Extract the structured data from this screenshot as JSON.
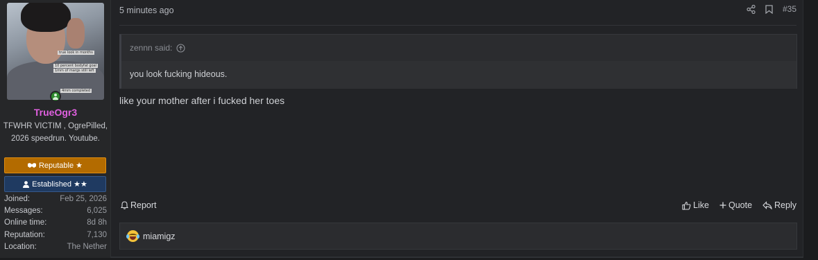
{
  "user": {
    "username": "TrueOgr3",
    "user_title": "TFWHR VICTIM , OgrePilled, 2026 speedrun. Youtube.",
    "avatar_captions": [
      "true look in months",
      "10 percent bodyfat goal",
      "1mm of margs still left",
      "4mm completed"
    ],
    "badges": [
      {
        "label": "Reputable ★",
        "icon": "handshake-icon",
        "color": "#b36b00"
      },
      {
        "label": "Established ★★",
        "icon": "user-icon",
        "color": "#1f3a61"
      }
    ],
    "stats": [
      {
        "label": "Joined:",
        "value": "Feb 25, 2026"
      },
      {
        "label": "Messages:",
        "value": "6,025"
      },
      {
        "label": "Online time:",
        "value": "8d 8h"
      },
      {
        "label": "Reputation:",
        "value": "7,130"
      },
      {
        "label": "Location:",
        "value": "The Nether"
      }
    ],
    "username_color": "#e060e0"
  },
  "post": {
    "time": "5 minutes ago",
    "number": "#35",
    "quote": {
      "author": "zennn said:",
      "text": "you look fucking hideous."
    },
    "message": "like your mother after i fucked her toes",
    "actions": {
      "report": "Report",
      "like": "Like",
      "quote": "Quote",
      "reply": "Reply"
    },
    "reactions": {
      "emoji": "laughing-crying-emoji",
      "users": "miamigz"
    }
  }
}
